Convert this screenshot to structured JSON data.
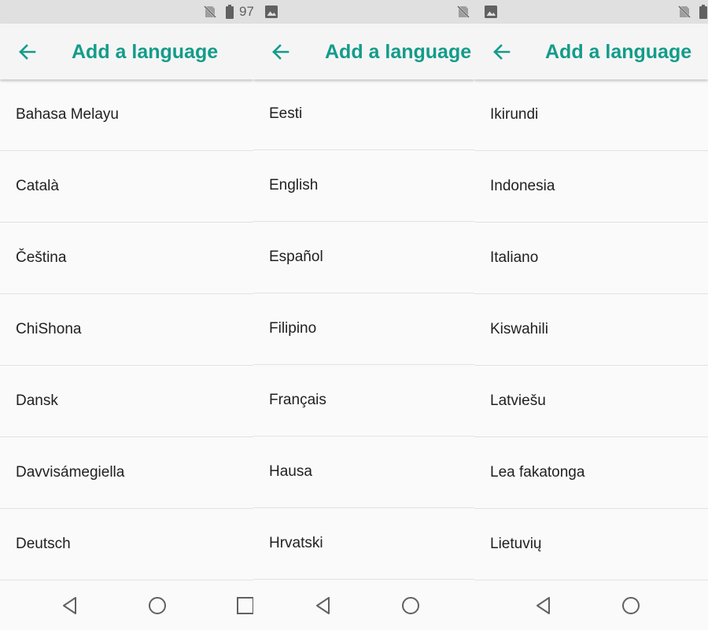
{
  "screens": [
    {
      "status": {
        "battery_text": "97"
      },
      "header": {
        "title": "Add a language"
      },
      "languages": [
        "Bahasa Melayu",
        "Català",
        "Čeština",
        "ChiShona",
        "Dansk",
        "Davvisámegiella",
        "Deutsch"
      ]
    },
    {
      "status": {},
      "header": {
        "title": "Add a language"
      },
      "languages": [
        "Eesti",
        "English",
        "Español",
        "Filipino",
        "Français",
        "Hausa",
        "Hrvatski"
      ]
    },
    {
      "status": {},
      "header": {
        "title": "Add a language"
      },
      "languages": [
        "Ikirundi",
        "Indonesia",
        "Italiano",
        "Kiswahili",
        "Latviešu",
        "Lea fakatonga",
        "Lietuvių"
      ]
    }
  ],
  "colors": {
    "accent": "#139c8a",
    "status_bar": "#e0e0e0",
    "app_bar": "#f5f5f5",
    "background": "#fafafa",
    "icon": "#616161"
  },
  "icons": {
    "status": [
      "no-sim-icon",
      "battery-icon",
      "image-notification-icon"
    ],
    "header": "back-arrow-icon",
    "navigation": [
      "nav-back-icon",
      "nav-home-icon",
      "nav-recents-icon"
    ]
  }
}
